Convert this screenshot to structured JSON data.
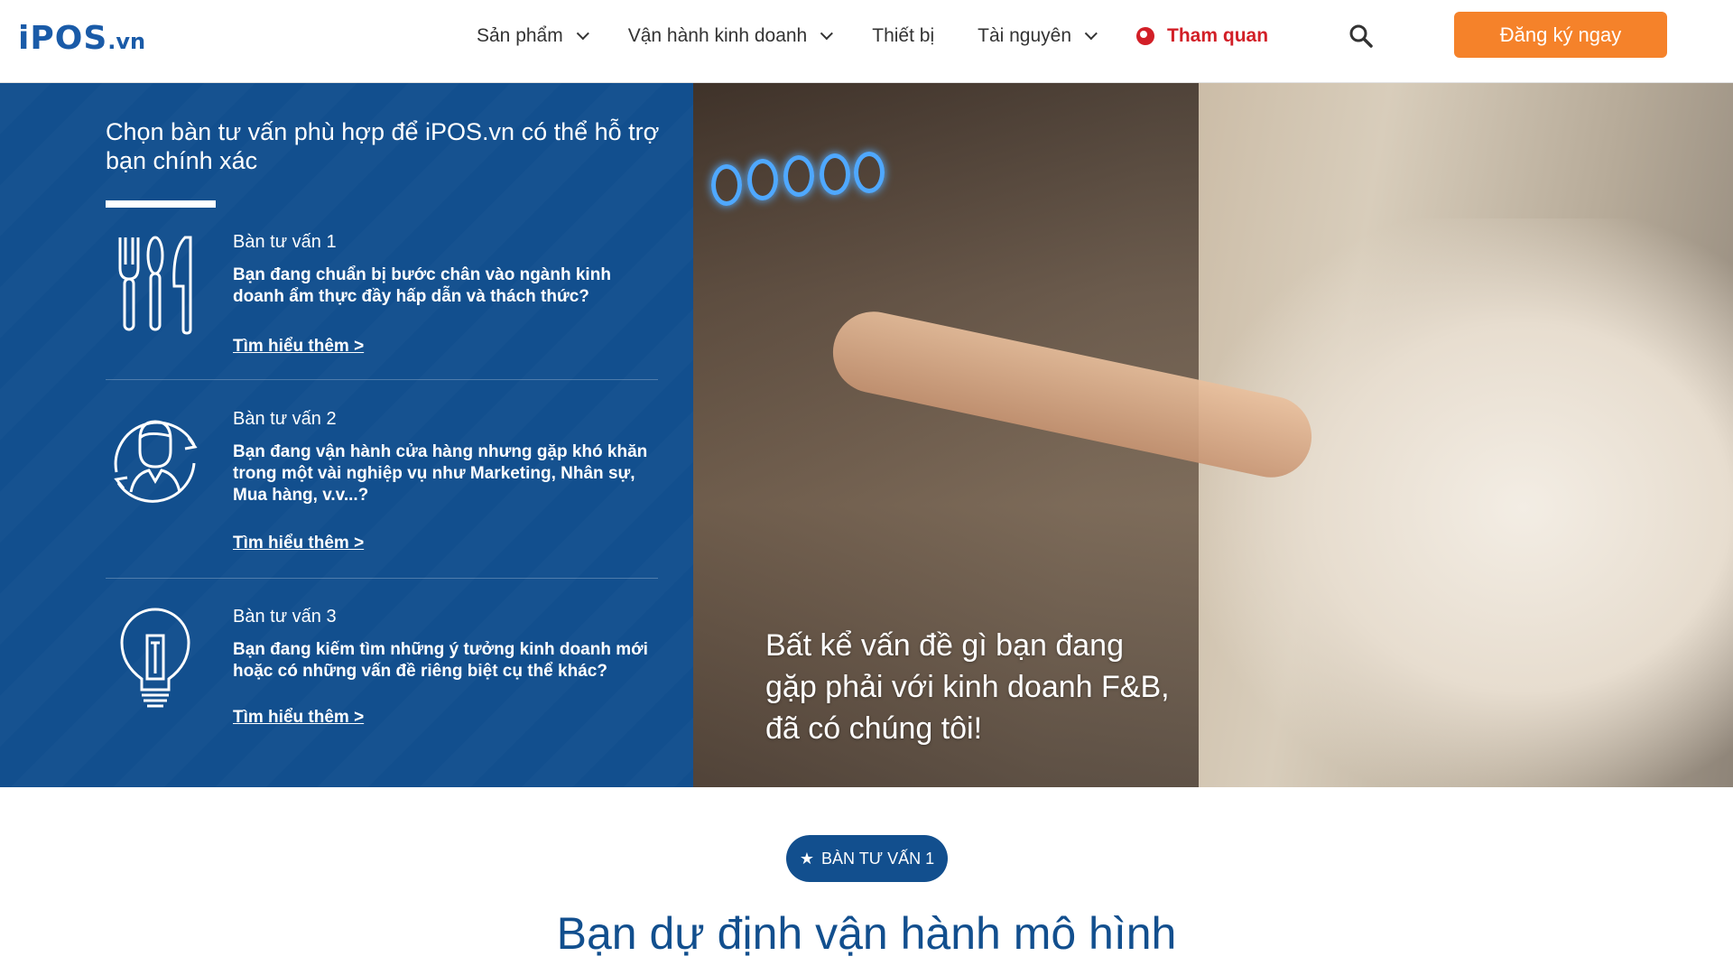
{
  "header": {
    "logo_main": "iPOS",
    "logo_suffix": ".vn",
    "nav": [
      {
        "label": "Sản phẩm",
        "has_dropdown": true
      },
      {
        "label": "Vận hành kinh doanh",
        "has_dropdown": true
      },
      {
        "label": "Thiết bị",
        "has_dropdown": false
      },
      {
        "label": "Tài nguyên",
        "has_dropdown": true
      }
    ],
    "visit_label": "Tham quan",
    "cta_label": "Đăng ký ngay",
    "colors": {
      "brand": "#124f8e",
      "cta": "#f5822a",
      "visit": "#d21f27"
    }
  },
  "hero": {
    "title": "Chọn bàn tư vấn phù hợp để iPOS.vn có thể hỗ trợ bạn chính xác",
    "advisors": [
      {
        "label": "Bàn tư vấn 1",
        "icon": "cutlery-icon",
        "description": "Bạn đang chuẩn bị bước chân vào ngành kinh doanh ẩm thực đầy hấp dẫn và thách thức?",
        "link": "Tìm hiểu thêm >"
      },
      {
        "label": "Bàn tư vấn 2",
        "icon": "person-cycle-icon",
        "description": "Bạn đang vận hành cửa hàng nhưng gặp khó khăn trong một vài nghiệp vụ như Marketing, Nhân sự, Mua hàng, v.v...?",
        "link": "Tìm hiểu thêm >"
      },
      {
        "label": "Bàn tư vấn 3",
        "icon": "lightbulb-icon",
        "description": "Bạn đang kiếm tìm những ý tưởng kinh doanh mới hoặc có những vấn đề riêng biệt cụ thể khác?",
        "link": "Tìm hiểu thêm >"
      }
    ],
    "quote_line1": "Bất kể vấn đề gì bạn đang",
    "quote_line2": "gặp phải với kinh doanh F&B,",
    "quote_line3": "đã có chúng tôi!"
  },
  "section": {
    "badge": "BÀN TƯ VẤN 1",
    "title": "Bạn dự định vận hành mô hình"
  }
}
